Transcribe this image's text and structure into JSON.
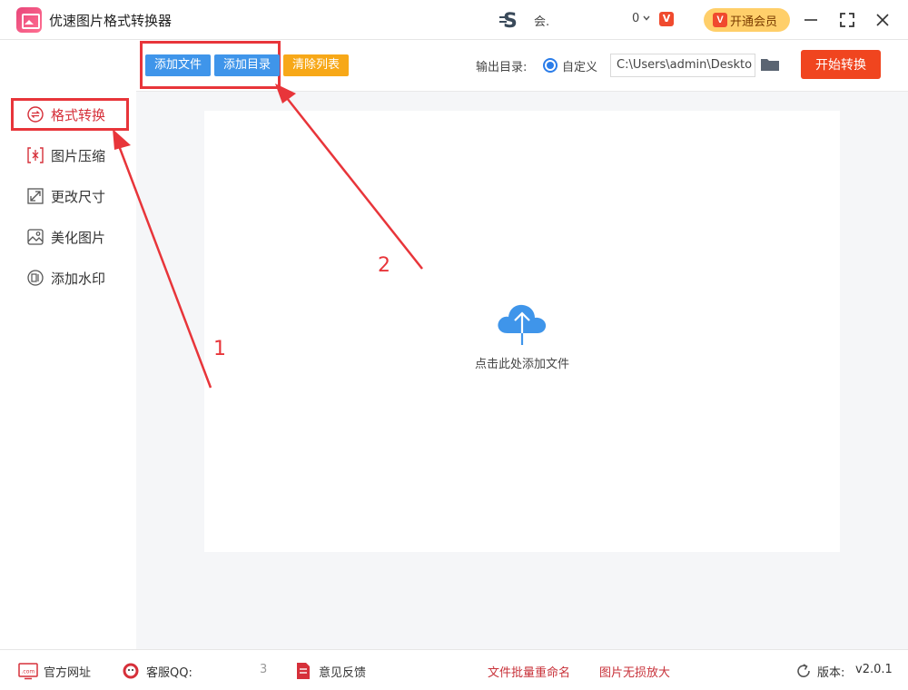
{
  "app": {
    "title": "优速图片格式转换器"
  },
  "header": {
    "user_name": "会.",
    "points": "0",
    "vip_button": "开通会员",
    "vip_icon": "V"
  },
  "sidebar": {
    "items": [
      {
        "label": "格式转换",
        "icon": "convert-icon",
        "active": true
      },
      {
        "label": "图片压缩",
        "icon": "compress-icon",
        "active": false
      },
      {
        "label": "更改尺寸",
        "icon": "resize-icon",
        "active": false
      },
      {
        "label": "美化图片",
        "icon": "beautify-icon",
        "active": false
      },
      {
        "label": "添加水印",
        "icon": "watermark-icon",
        "active": false
      }
    ]
  },
  "toolbar": {
    "add_file": "添加文件",
    "add_dir": "添加目录",
    "clear_list": "清除列表",
    "output_label": "输出目录:",
    "output_option": "自定义",
    "output_path": "C:\\Users\\admin\\Deskto",
    "start": "开始转换"
  },
  "dropzone": {
    "text": "点击此处添加文件"
  },
  "footer": {
    "website": "官方网址",
    "website_icon": ".com",
    "service_qq": "客服QQ:",
    "service_qq_tail": "3",
    "feedback": "意见反馈",
    "batch_rename": "文件批量重命名",
    "lossless_zoom": "图片无损放大",
    "version_label": "版本:",
    "version_value": "v2.0.1"
  },
  "annotations": {
    "step1": "1",
    "step2": "2"
  },
  "colors": {
    "accent_red": "#e8353a",
    "primary_blue": "#3f95ea",
    "orange": "#f7a818",
    "start_red": "#f0451f"
  }
}
